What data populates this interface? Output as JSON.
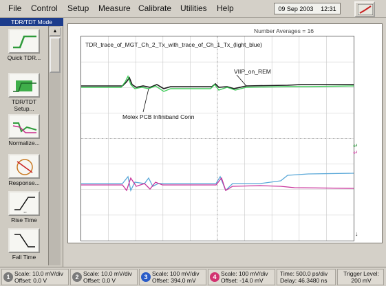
{
  "menu": [
    "File",
    "Control",
    "Setup",
    "Measure",
    "Calibrate",
    "Utilities",
    "Help"
  ],
  "datetime": {
    "date": "09 Sep 2003",
    "time": "12:31"
  },
  "sidebar": {
    "title": "TDR/TDT Mode",
    "tools": [
      {
        "label": "Quick TDR..."
      },
      {
        "label": "TDR/TDT Setup..."
      },
      {
        "label": "Normalize..."
      },
      {
        "label": "Response..."
      },
      {
        "label": "Rise Time"
      },
      {
        "label": "Fall Time"
      }
    ]
  },
  "display": {
    "averages": "Number Averages = 16",
    "trace_title": "TDR_trace_of_MGT_Ch_2_Tx_with_trace_of_Ch_1_Tx_(light_blue)",
    "annotation_via": "VIIP_on_REM",
    "annotation_conn": "Molex PCB Infiniband Conn",
    "colors": {
      "green": "#2ec84a",
      "black": "#1a1a1a",
      "magenta": "#c8329a",
      "blue": "#5aa8d8"
    }
  },
  "channels": [
    {
      "id": "1",
      "scale": "Scale: 10.0 mV/div",
      "offset": "Offset: 0.0 V",
      "color": "#f2f2ee",
      "text_color": "#111111"
    },
    {
      "id": "2",
      "scale": "Scale: 10.0 mV/div",
      "offset": "Offset: 0.0 V",
      "color": "#e6e6e0",
      "text_color": "#111111"
    },
    {
      "id": "3",
      "scale": "Scale: 100 mV/div",
      "offset": "Offset: 394.0 mV",
      "color": "#2a5cc8",
      "text_color": "#ffffff"
    },
    {
      "id": "4",
      "scale": "Scale: 100 mV/div",
      "offset": "Offset: -14.0 mV",
      "color": "#d23270",
      "text_color": "#ffffff"
    }
  ],
  "timebase": {
    "time": "Time: 500.0 ps/div",
    "delay": "Delay: 46.3480 ns"
  },
  "trigger": {
    "label": "Trigger Level:",
    "value": "200 mV"
  }
}
